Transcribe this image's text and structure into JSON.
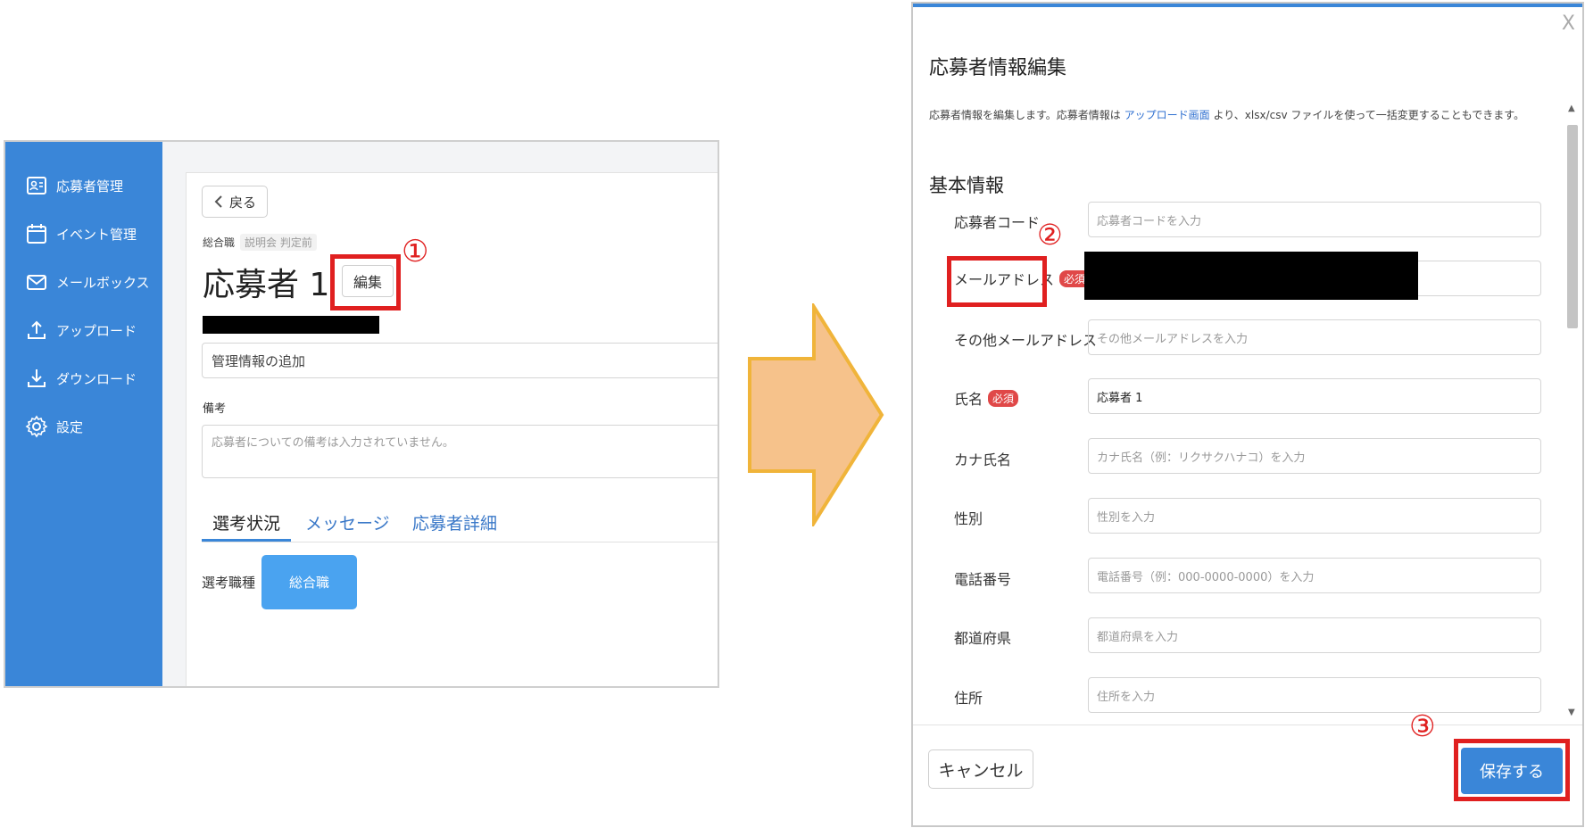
{
  "sidebar": {
    "items": [
      {
        "label": "応募者管理",
        "icon": "id-card-icon"
      },
      {
        "label": "イベント管理",
        "icon": "calendar-icon"
      },
      {
        "label": "メールボックス",
        "icon": "mail-icon"
      },
      {
        "label": "アップロード",
        "icon": "upload-icon"
      },
      {
        "label": "ダウンロード",
        "icon": "download-icon"
      },
      {
        "label": "設定",
        "icon": "gear-icon"
      }
    ]
  },
  "applicant_page": {
    "back_label": "戻る",
    "tags": [
      "総合職",
      "説明会 判定前"
    ],
    "applicant_name": "応募者 1",
    "edit_label": "編集",
    "mgmt_placeholder": "管理情報の追加",
    "memo_label": "備考",
    "memo_placeholder": "応募者についての備考は入力されていません。",
    "tabs": [
      "選考状況",
      "メッセージ",
      "応募者詳細"
    ],
    "job_type_label": "選考職種",
    "job_type_value": "総合職"
  },
  "annotations": {
    "step1": "①",
    "step2": "②",
    "step3": "③"
  },
  "edit_modal": {
    "close_label": "X",
    "title": "応募者情報編集",
    "desc_before": "応募者情報を編集します。応募者情報は",
    "desc_link": "アップロード画面",
    "desc_after": "より、xlsx/csv ファイルを使って一括変更することもできます。",
    "section_title": "基本情報",
    "required_badge": "必須",
    "fields": [
      {
        "label": "応募者コード",
        "placeholder": "応募者コードを入力",
        "value": ""
      },
      {
        "label": "メールアドレス",
        "placeholder": "",
        "value": ""
      },
      {
        "label": "その他メールアドレス",
        "placeholder": "その他メールアドレスを入力",
        "value": ""
      },
      {
        "label": "氏名",
        "placeholder": "",
        "value": "応募者 1"
      },
      {
        "label": "カナ氏名",
        "placeholder": "カナ氏名（例：リクサクハナコ）を入力",
        "value": ""
      },
      {
        "label": "性別",
        "placeholder": "性別を入力",
        "value": ""
      },
      {
        "label": "電話番号",
        "placeholder": "電話番号（例：000-0000-0000）を入力",
        "value": ""
      },
      {
        "label": "都道府県",
        "placeholder": "都道府県を入力",
        "value": ""
      },
      {
        "label": "住所",
        "placeholder": "住所を入力",
        "value": ""
      }
    ],
    "cancel_label": "キャンセル",
    "save_label": "保存する"
  },
  "colors": {
    "accent": "#3a86d8",
    "annotation": "#e02020",
    "arrow_fill": "#f6c28b",
    "arrow_stroke": "#f0b43a"
  }
}
